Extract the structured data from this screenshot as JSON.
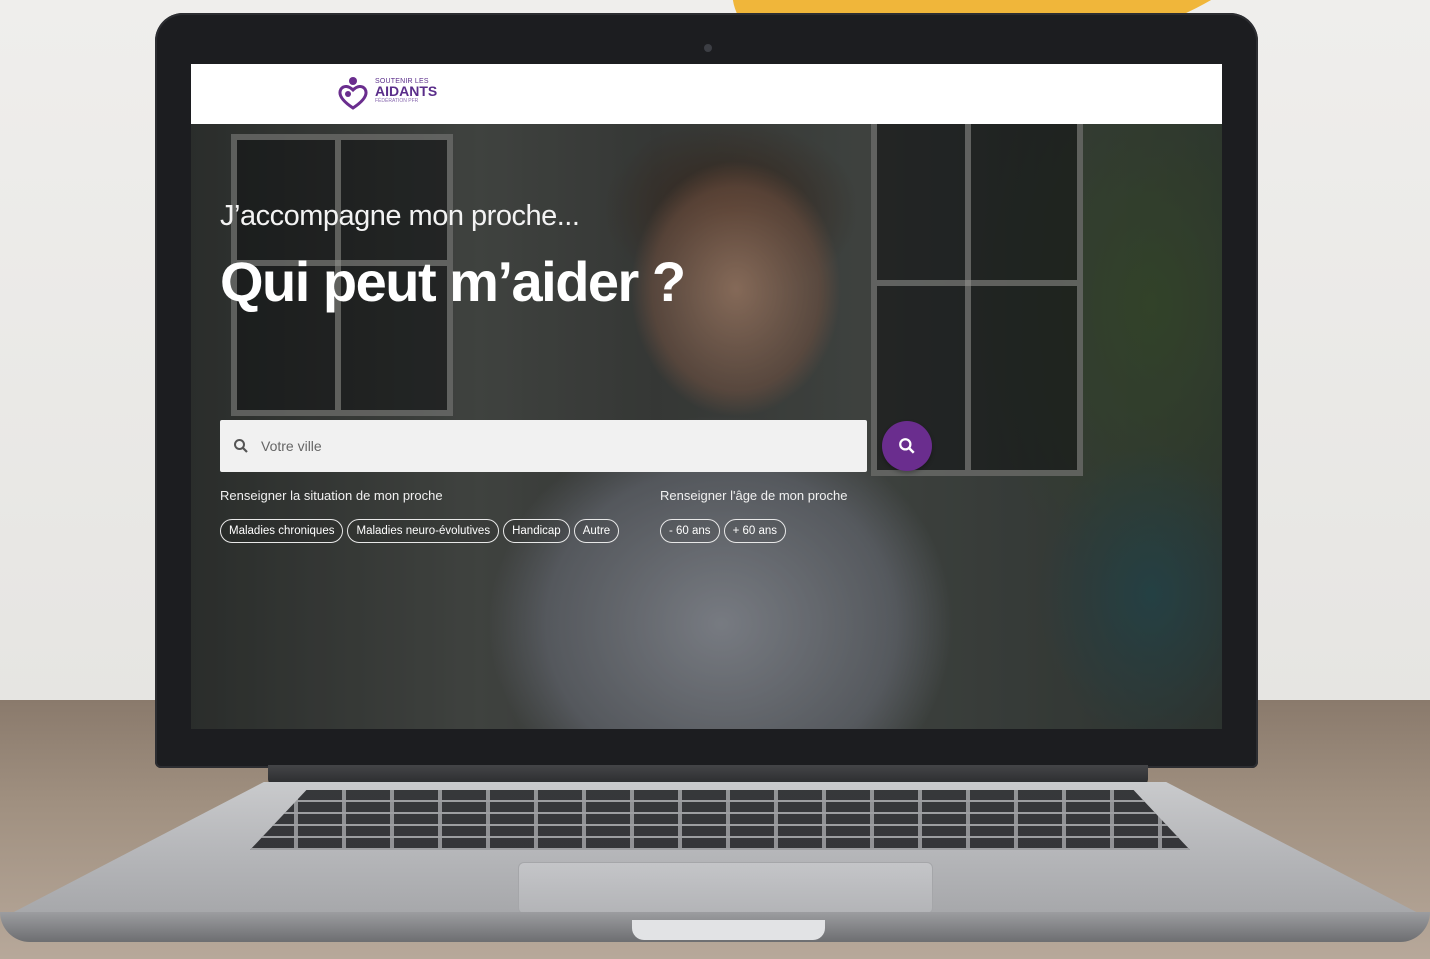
{
  "brand": {
    "logo_small": "SOUTENIR LES",
    "logo_big": "AIDANTS",
    "logo_tiny": "FÉDÉRATION PFR",
    "accent_color": "#6a2d8e"
  },
  "hero": {
    "subtitle": "J’accompagne mon proche...",
    "title": "Qui peut m’aider ?"
  },
  "search": {
    "placeholder": "Votre ville",
    "icon": "search-icon",
    "button_icon": "search-icon"
  },
  "situation": {
    "label": "Renseigner la situation de mon proche",
    "options": [
      "Maladies chroniques",
      "Maladies neuro-évolutives",
      "Handicap",
      "Autre"
    ]
  },
  "age": {
    "label": "Renseigner l'âge de mon proche",
    "options": [
      "- 60 ans",
      "+ 60 ans"
    ]
  }
}
